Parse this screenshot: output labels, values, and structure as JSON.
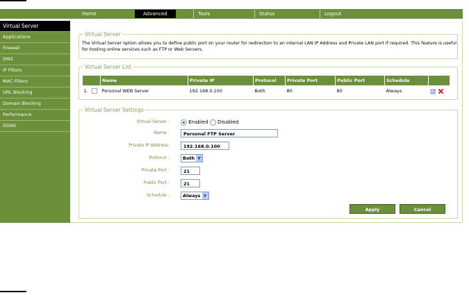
{
  "nav": {
    "tabs": [
      {
        "label": "Home"
      },
      {
        "label": "Advanced"
      },
      {
        "label": "Tools"
      },
      {
        "label": "Status"
      },
      {
        "label": "Logout"
      }
    ]
  },
  "sidebar": {
    "items": [
      {
        "label": "Virtual Server"
      },
      {
        "label": "Applications"
      },
      {
        "label": "Firewall"
      },
      {
        "label": "DMZ"
      },
      {
        "label": "IP Filters"
      },
      {
        "label": "MAC Filters"
      },
      {
        "label": "URL Blocking"
      },
      {
        "label": "Domain Blocking"
      },
      {
        "label": "Performance"
      },
      {
        "label": "DDNS"
      }
    ]
  },
  "virtual_server": {
    "title": "Virtual Server",
    "description": "The Virtual Server option allows you to define public port on your router for redirection to an internal LAN IP Address and Private LAN port if required. This feature is useful for hosting online services such as FTP or Web Servers."
  },
  "list": {
    "title": "Virtual Server List",
    "headers": {
      "name": "Name",
      "private_ip": "Private IP",
      "protocol": "Protocol",
      "private_port": "Private Port",
      "public_port": "Public Port",
      "schedule": "Schedule"
    },
    "rows": [
      {
        "index": "1.",
        "name": "Personal WEB Server",
        "private_ip": "192.168.0.100",
        "protocol": "Both",
        "private_port": "80",
        "public_port": "80",
        "schedule": "Always"
      }
    ]
  },
  "settings": {
    "title": "Virtual Server Settings",
    "virtual_server_label": "Virtual Server :",
    "enabled_label": "Enabled",
    "disabled_label": "Disabled",
    "name_label": "Name :",
    "name_value": "Personal FTP Server",
    "private_ip_label": "Private IP Address:",
    "private_ip_value": "192.168.0.100",
    "protocol_label": "Protocol :",
    "protocol_value": "Both",
    "private_port_label": "Private Port :",
    "private_port_value": "21",
    "public_port_label": "Public Port :",
    "public_port_value": "21",
    "schedule_label": "Schedule :",
    "schedule_value": "Always"
  },
  "buttons": {
    "apply": "Apply",
    "cancel": "Cancel"
  },
  "colors": {
    "brand_green": "#6b8f3a",
    "active_black": "#000000",
    "legend_green": "#7da05a"
  }
}
